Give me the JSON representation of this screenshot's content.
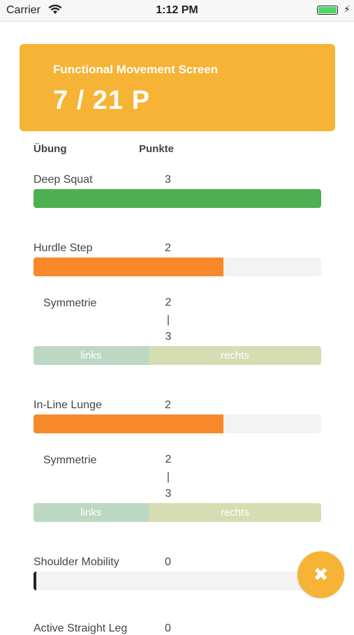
{
  "status_bar": {
    "carrier": "Carrier",
    "time": "1:12 PM"
  },
  "score": {
    "title": "Functional Movement Screen",
    "value": "7 / 21 P"
  },
  "table_header": {
    "exercise": "Übung",
    "points": "Punkte"
  },
  "colors": {
    "good": "#4caf50",
    "medium": "#f7892a",
    "poor": "#222222",
    "accent": "#f6b335"
  },
  "exercises": [
    {
      "name": "Deep Squat",
      "points": "3",
      "fill": 1.0,
      "color": "#4caf50"
    },
    {
      "name": "Hurdle Step",
      "points": "2",
      "fill": 0.66,
      "color": "#f7892a",
      "symmetry": {
        "label": "Symmetrie",
        "left_value": "2",
        "divider": "|",
        "right_value": "3",
        "left_label": "links",
        "right_label": "rechts",
        "left_ratio": 0.4
      }
    },
    {
      "name": "In-Line Lunge",
      "points": "2",
      "fill": 0.66,
      "color": "#f7892a",
      "symmetry": {
        "label": "Symmetrie",
        "left_value": "2",
        "divider": "|",
        "right_value": "3",
        "left_label": "links",
        "right_label": "rechts",
        "left_ratio": 0.4
      }
    },
    {
      "name": "Shoulder Mobility",
      "points": "0",
      "fill": 0.01,
      "color": "#222222"
    },
    {
      "name": "Active Straight Leg",
      "points": "0"
    }
  ],
  "fab": {
    "icon": "close-icon",
    "glyph": "✖"
  }
}
